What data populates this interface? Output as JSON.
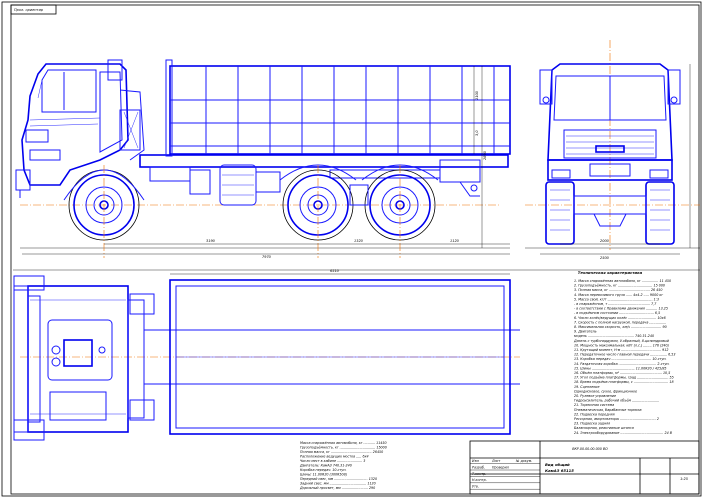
{
  "drawing": {
    "corner_stamp": "Прол. ориентир",
    "side_dims": {
      "h1": "3,0",
      "h2": "2890",
      "h3": "1100",
      "wheelbase_front": "3190",
      "rear_overhang": "1320",
      "total_length": "7970",
      "rear": "1120"
    },
    "front_dims": {
      "track": "2000",
      "width": "2500"
    },
    "plan_dims": {
      "body_length": "6510"
    }
  },
  "specs": {
    "heading": "Техническая характеристика",
    "lines": [
      "1. Масса снаряжённая автомобиля, кг ................ 11 450",
      "2. Грузоподъёмность, кг ................................. 15 000",
      "3. Полная масса, кг ....................................... 26 450",
      "4. Масса перевозимого груза ...... 4х4-2 ..... 9000 кг",
      "5. Масса свой, кг/т ........................................... 1:3",
      "   - в снаряжённом, т ........................................ 7,7",
      "   - в соответствии с Правилами движения ........... 13,25",
      "   - в подъёмном состоянии ................................. 6,5",
      "6. Число колёс/ведущих колёс ........................... 10х6",
      "7. Скорость с полной нагрузкой, передача ................",
      "8. Максимальная скорость, км/ч ............................. 90",
      "9. Двигатель",
      "   модель ............................................ 740.31-240",
      "   Дизель с турбонаддувом, V-образный, 8-цилиндровый",
      "10. Мощность максимальная, кВт (л.с.) ........ 176 (240)",
      "11. Крутящий момент, Н·м ...................................... 912",
      "12. Передаточное число главной передачи ................ 6,53",
      "13. Коробка передач ...................................... 10-ступ.",
      "14. Раздаточная коробка .................................... 2-ступ.",
      "15. Шины ......................................... 11.00R20 / 425/85",
      "16. Объём платформы, м³ ........................................ 10,5",
      "17. Угол подъёма платформы, град .............................. 55",
      "18. Время подъёма платформы, с ................................. 18",
      "19. Сцепление",
      "   Однодисковое, сухое, фрикционное",
      "20. Рулевое управление",
      "   Гидроусилитель, рабочий объём ..........................",
      "21. Тормозная система",
      "   Пневматическая, барабанные тормоза",
      "22. Подвеска передняя",
      "   Рессорная, амортизаторы .................................. 2",
      "23. Подвеска задняя",
      "   Балансирная, реактивные штанги",
      "24. Электрооборудование ......................................... 24 В"
    ]
  },
  "stamp": {
    "rows": [
      {
        "no": "Изм",
        "text": "Лист",
        "qty": "№ докум."
      },
      {
        "no": "Разраб.",
        "text": "Проверил",
        "qty": ""
      },
      {
        "no": "Т.контр.",
        "text": "",
        "qty": ""
      },
      {
        "no": "Н.контр.",
        "text": "",
        "qty": ""
      },
      {
        "no": "Утв.",
        "text": "",
        "qty": ""
      }
    ],
    "title_line1": "Вид общий",
    "title_line2": "КамАЗ 65115",
    "code": "ВКР.00.00.00.000 ВО",
    "sheet": "1:25",
    "left_notes": [
      "Масса снаряжённая автомобиля, кг ........... 11450",
      "Грузоподъёмность, кг .................................. 15000",
      "Полная масса, кг ....................................... 26450",
      "Расположение ведущих мостов ..... 6х4",
      "Число мест в кабине ........................ 3",
      "Двигатель: КамАЗ 740.31-240",
      "Коробка передач: 10-ступ.",
      "Шины: 11.00R20 (300R508)",
      "Передний свес, мм ................................ 1320",
      "Задний свес, мм ................................... 1120",
      "Дорожный просвет, мм ......................... 290"
    ]
  }
}
